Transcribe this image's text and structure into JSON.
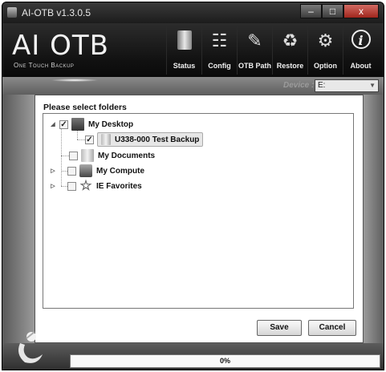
{
  "window": {
    "title": "AI-OTB v1.3.0.5",
    "minimize": "–",
    "maximize": "□",
    "close": "x"
  },
  "header": {
    "logo": "AI OTB",
    "logo_sub": "One Touch Backup"
  },
  "toolbar": [
    {
      "label": "Status",
      "icon": "status-icon"
    },
    {
      "label": "Config",
      "icon": "config-icon"
    },
    {
      "label": "OTB Path",
      "icon": "otb-path-icon"
    },
    {
      "label": "Restore",
      "icon": "restore-icon"
    },
    {
      "label": "Option",
      "icon": "gear-icon"
    },
    {
      "label": "About",
      "icon": "info-icon"
    }
  ],
  "device": {
    "label": "Device :",
    "value": "E:"
  },
  "panel": {
    "title": "Please select folders"
  },
  "tree": [
    {
      "label": "My Desktop",
      "checked": true,
      "expanded": true
    },
    {
      "label": "U338-000 Test Backup",
      "checked": true,
      "selected": true
    },
    {
      "label": "My Documents",
      "checked": false
    },
    {
      "label": "My Compute",
      "checked": false,
      "collapsed": true
    },
    {
      "label": "IE Favorites",
      "checked": false,
      "collapsed": true
    }
  ],
  "buttons": {
    "save": "Save",
    "cancel": "Cancel"
  },
  "progress": {
    "text": "0%",
    "value": 0
  }
}
